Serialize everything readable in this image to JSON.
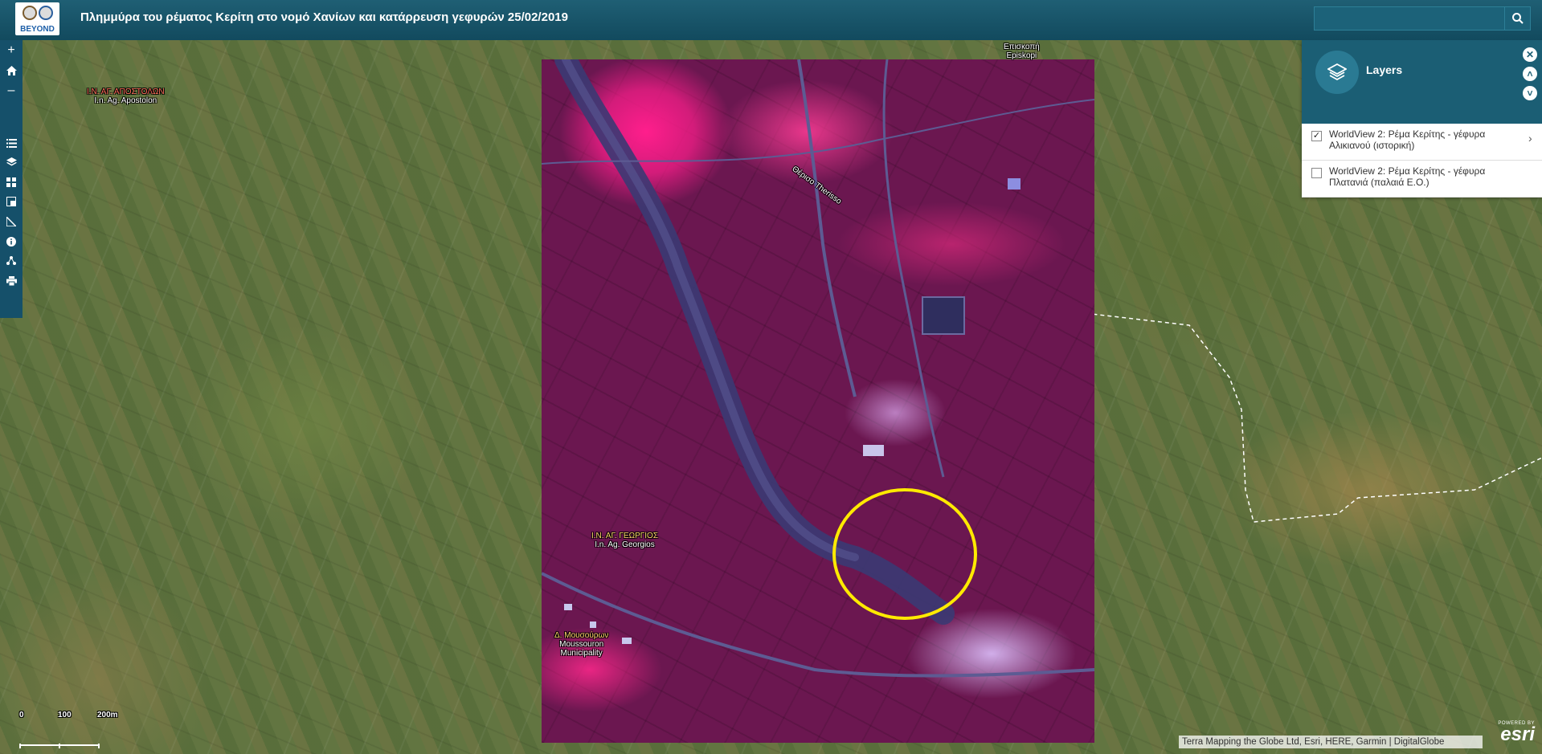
{
  "header": {
    "logo_text": "BEYOND",
    "title": "Πλημμύρα του ρέματος Κερίτη στο νομό Χανίων και κατάρρευση γεφυρών 25/02/2019",
    "search_value": ""
  },
  "toolbar": {
    "items": [
      "zoom-in",
      "home",
      "zoom-out",
      "legend",
      "layers",
      "basemap-gallery",
      "overview",
      "measure",
      "about",
      "share",
      "print"
    ]
  },
  "map": {
    "labels": {
      "agios_apostolon_gr": "Ι.Ν. ΑΓ. ΑΠΟΣΤΟΛΩΝ",
      "agios_apostolon_en": "I.n. Ag. Apostolon",
      "episkopi_gr": "Επισκοπή",
      "episkopi_en": "Episkopi",
      "therisso": "Θέρισο Therisso",
      "agios_georgios_gr": "Ι.Ν. ΑΓ. ΓΕΩΡΓΙΟΣ",
      "agios_georgios_en": "I.n. Ag. Georgios",
      "mousouron_gr": "Δ. Μουσούρων",
      "mousouron_en1": "Moussouron",
      "mousouron_en2": "Municipality"
    },
    "scale": {
      "labels": [
        "0",
        "100",
        "200m"
      ]
    },
    "attribution": "Terra Mapping the Globe Ltd, Esri, HERE, Garmin | DigitalGlobe",
    "esri": {
      "powered": "POWERED BY",
      "brand": "esri"
    },
    "highlight_color": "#ffea00"
  },
  "layers_panel": {
    "title": "Layers",
    "layers": [
      {
        "label": "WorldView 2: Ρέμα Κερίτης - γέφυρα Αλικιανού (ιστορική)",
        "checked": true
      },
      {
        "label": "WorldView 2: Ρέμα Κερίτης - γέφυρα Πλατανιά (παλαιά Ε.Ο.)",
        "checked": false
      }
    ]
  }
}
